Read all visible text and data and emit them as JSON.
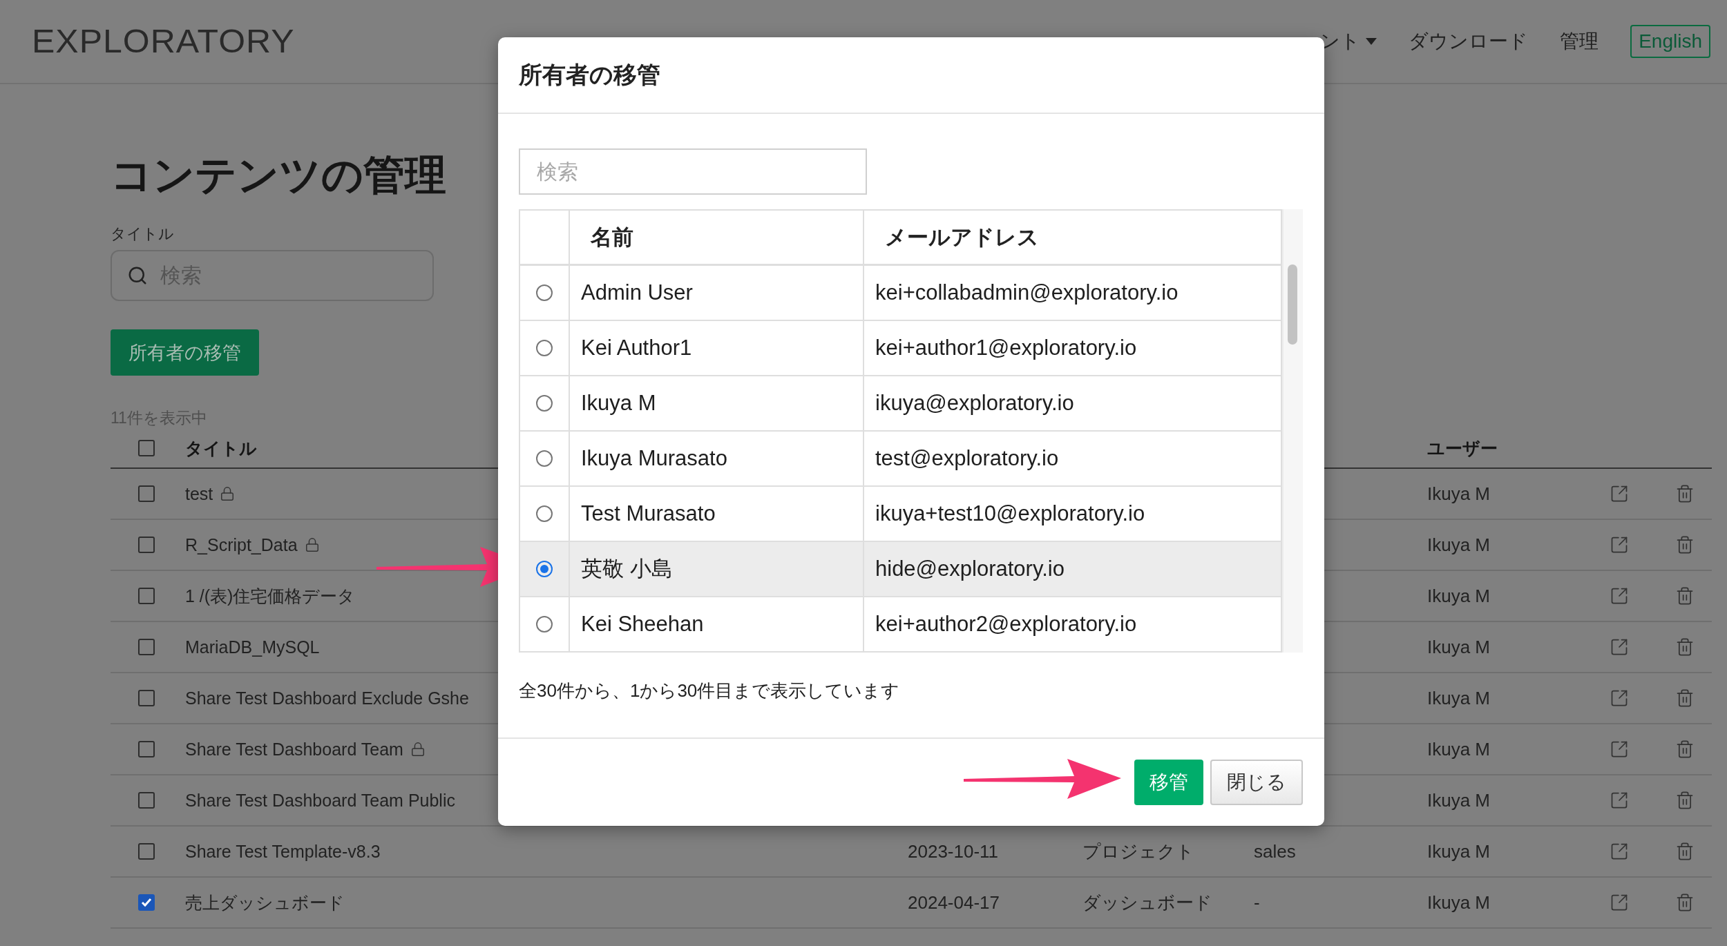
{
  "header": {
    "logo": "EXPLORATORY",
    "nav": [
      {
        "label": "ント",
        "kind": "dropdown"
      },
      {
        "label": "ダウンロード",
        "kind": "link"
      },
      {
        "label": "管理",
        "kind": "link"
      },
      {
        "label": "English",
        "kind": "outline"
      }
    ]
  },
  "page": {
    "title": "コンテンツの管理",
    "filter_label": "タイトル",
    "search": {
      "placeholder": "検索"
    },
    "transfer_button": "所有者の移管",
    "count": "11件を表示中"
  },
  "table": {
    "header_checked": false,
    "title_header": "タイトル",
    "user_header": "ユーザー",
    "rows": [
      {
        "title": "test",
        "locked": true,
        "checked": false,
        "user": "Ikuya M"
      },
      {
        "title": "R_Script_Data",
        "locked": true,
        "checked": false,
        "user": "Ikuya M"
      },
      {
        "title": "1 /(表)住宅価格データ",
        "locked": false,
        "checked": false,
        "user": "Ikuya M"
      },
      {
        "title": "MariaDB_MySQL",
        "locked": false,
        "checked": false,
        "user": "Ikuya M"
      },
      {
        "title": "Share Test Dashboard Exclude Gshe",
        "locked": false,
        "checked": false,
        "user": "Ikuya M"
      },
      {
        "title": "Share Test Dashboard Team",
        "locked": true,
        "checked": false,
        "user": "Ikuya M"
      },
      {
        "title": "Share Test Dashboard Team Public",
        "locked": false,
        "checked": false,
        "user": "Ikuya M"
      },
      {
        "title": "Share Test Template-v8.3",
        "locked": false,
        "checked": false,
        "date": "2023-10-11",
        "type": "プロジェクト",
        "tag": "sales",
        "user": "Ikuya M"
      },
      {
        "title": "売上ダッシュボード",
        "locked": false,
        "checked": true,
        "date": "2024-04-17",
        "type": "ダッシュボード",
        "tag": "-",
        "user": "Ikuya M"
      }
    ]
  },
  "dialog": {
    "title": "所有者の移管",
    "search": {
      "placeholder": "検索"
    },
    "columns": [
      "名前",
      "メールアドレス"
    ],
    "rows": [
      {
        "name": "Admin User",
        "email": "kei+collabadmin@exploratory.io",
        "selected": false
      },
      {
        "name": "Kei Author1",
        "email": "kei+author1@exploratory.io",
        "selected": false
      },
      {
        "name": "Ikuya M",
        "email": "ikuya@exploratory.io",
        "selected": false
      },
      {
        "name": "Ikuya Murasato",
        "email": "test@exploratory.io",
        "selected": false
      },
      {
        "name": "Test Murasato",
        "email": "ikuya+test10@exploratory.io",
        "selected": false
      },
      {
        "name": "英敬 小島",
        "email": "hide@exploratory.io",
        "selected": true
      },
      {
        "name": "Kei Sheehan",
        "email": "kei+author2@exploratory.io",
        "selected": false
      }
    ],
    "summary": "全30件から、1から30件目まで表示しています",
    "buttons": [
      {
        "label": "移管",
        "kind": "primary"
      },
      {
        "label": "閉じる",
        "kind": "default"
      }
    ]
  }
}
